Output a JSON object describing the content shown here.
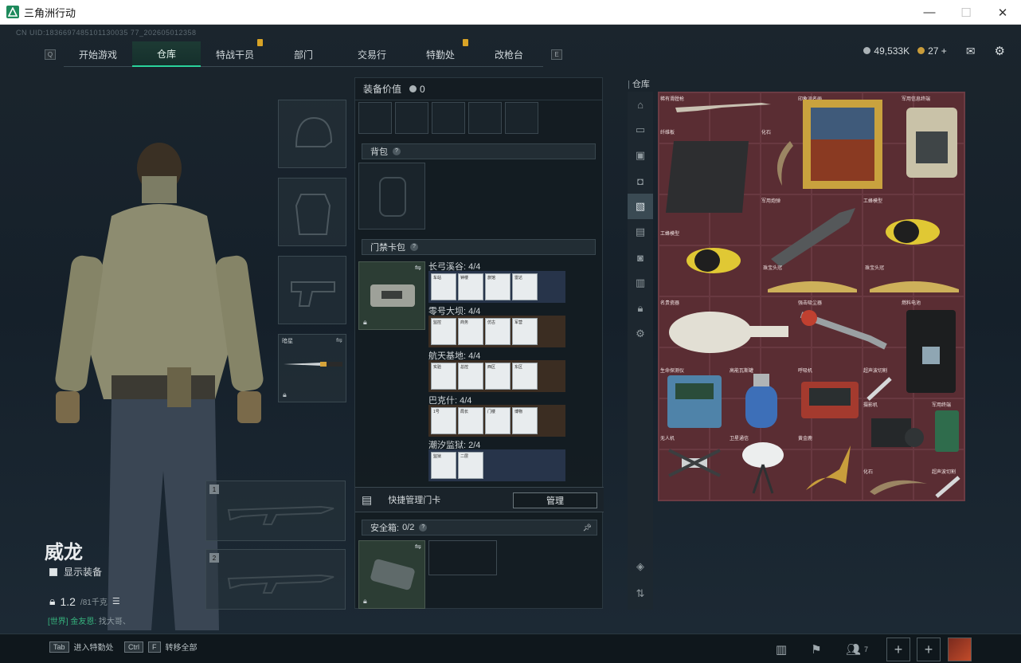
{
  "window": {
    "title": "三角洲行动",
    "controls": [
      "—",
      "☐",
      "✕"
    ]
  },
  "uid": "CN UID:1836697485101130035 77_202605012358",
  "nav": {
    "left_key": "Q",
    "right_key": "E",
    "tabs": [
      "开始游戏",
      "仓库",
      "特战干员",
      "部门",
      "交易行",
      "特勤处",
      "改枪台"
    ],
    "active": "仓库"
  },
  "currency": {
    "silver": "49,533K",
    "gold": "27 +"
  },
  "character": {
    "name": "威龙",
    "show_equipment": "显示装备",
    "weight": "1.2",
    "weight_max": "/81千克",
    "chat_channel": "[世界]",
    "chat_user": "金友恩:",
    "chat_text": "找大哥、"
  },
  "left_slots": {
    "melee_label": "暗星",
    "slot1": "1",
    "slot2": "2"
  },
  "equipment": {
    "value_label": "装备价值",
    "value": "0",
    "backpack_label": "背包",
    "keycard_label": "门禁卡包",
    "maps": [
      {
        "name": "长弓溪谷: 4/4",
        "cards": [
          "车站",
          "钟楼",
          "旅馆",
          "雷达"
        ],
        "tone": "blue"
      },
      {
        "name": "零号大坝: 4/4",
        "cards": [
          "监控",
          "商务",
          "仿古",
          "军营"
        ],
        "tone": "brown"
      },
      {
        "name": "航天基地: 4/4",
        "cards": [
          "实验",
          "总控",
          "西区",
          "东区"
        ],
        "tone": "brown"
      },
      {
        "name": "巴克什: 4/4",
        "cards": [
          "1号",
          "局长",
          "门楼",
          "博物"
        ],
        "tone": "brown"
      },
      {
        "name": "潮汐监狱: 2/4",
        "cards": [
          "监狱",
          "二层"
        ],
        "tone": "blue"
      }
    ],
    "quick_manage": "快捷管理门卡",
    "manage_btn": "管理",
    "safebox_label": "安全箱:",
    "safebox_value": "0/2"
  },
  "warehouse": {
    "title": "仓库",
    "items": [
      "稀有滑膛枪",
      "印象派名画",
      "军用信息终端",
      "纤维板",
      "化石",
      "军用炮弹",
      "工蜂模型",
      "工蜂模型",
      "珠宝头冠",
      "珠宝头冠",
      "名贵瓷器",
      "强击吸尘器",
      "燃料电池",
      "生命探测仪",
      "高能瓦斯罐",
      "呼吸机",
      "超声波切割",
      "摄影机",
      "军用终端",
      "无人机",
      "卫星通信",
      "黄金鹿",
      "化石",
      "超声波切割"
    ]
  },
  "bottom": {
    "hint1_key": "Tab",
    "hint1": "进入特勤处",
    "hint2_key1": "Ctrl",
    "hint2_key2": "F",
    "hint2": "转移全部",
    "friends": "7"
  }
}
